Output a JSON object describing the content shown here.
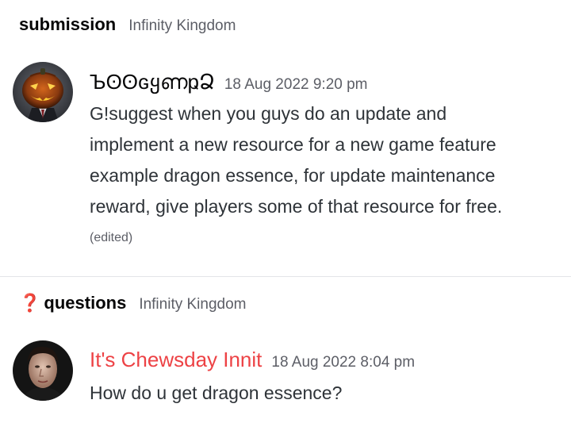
{
  "messages": [
    {
      "channel": {
        "emoji": "",
        "name": "submission",
        "server": "Infinity Kingdom"
      },
      "author": {
        "name": "ЪʘʘɢყണҏՁ",
        "color": "#060607"
      },
      "timestamp": "18 Aug 2022 9:20 pm",
      "lines": [
        "G!suggest when you guys do an update and",
        "implement a new resource for a new game feature",
        "example dragon essence, for update maintenance",
        "reward, give players some of that resource for free."
      ],
      "edited_label": "(edited)"
    },
    {
      "channel": {
        "emoji": "❓",
        "name": "questions",
        "server": "Infinity Kingdom"
      },
      "author": {
        "name": "It's Chewsday Innit",
        "color": "#ed4245"
      },
      "timestamp": "18 Aug 2022 8:04 pm",
      "lines": [
        "How do u get dragon essence?"
      ]
    }
  ]
}
